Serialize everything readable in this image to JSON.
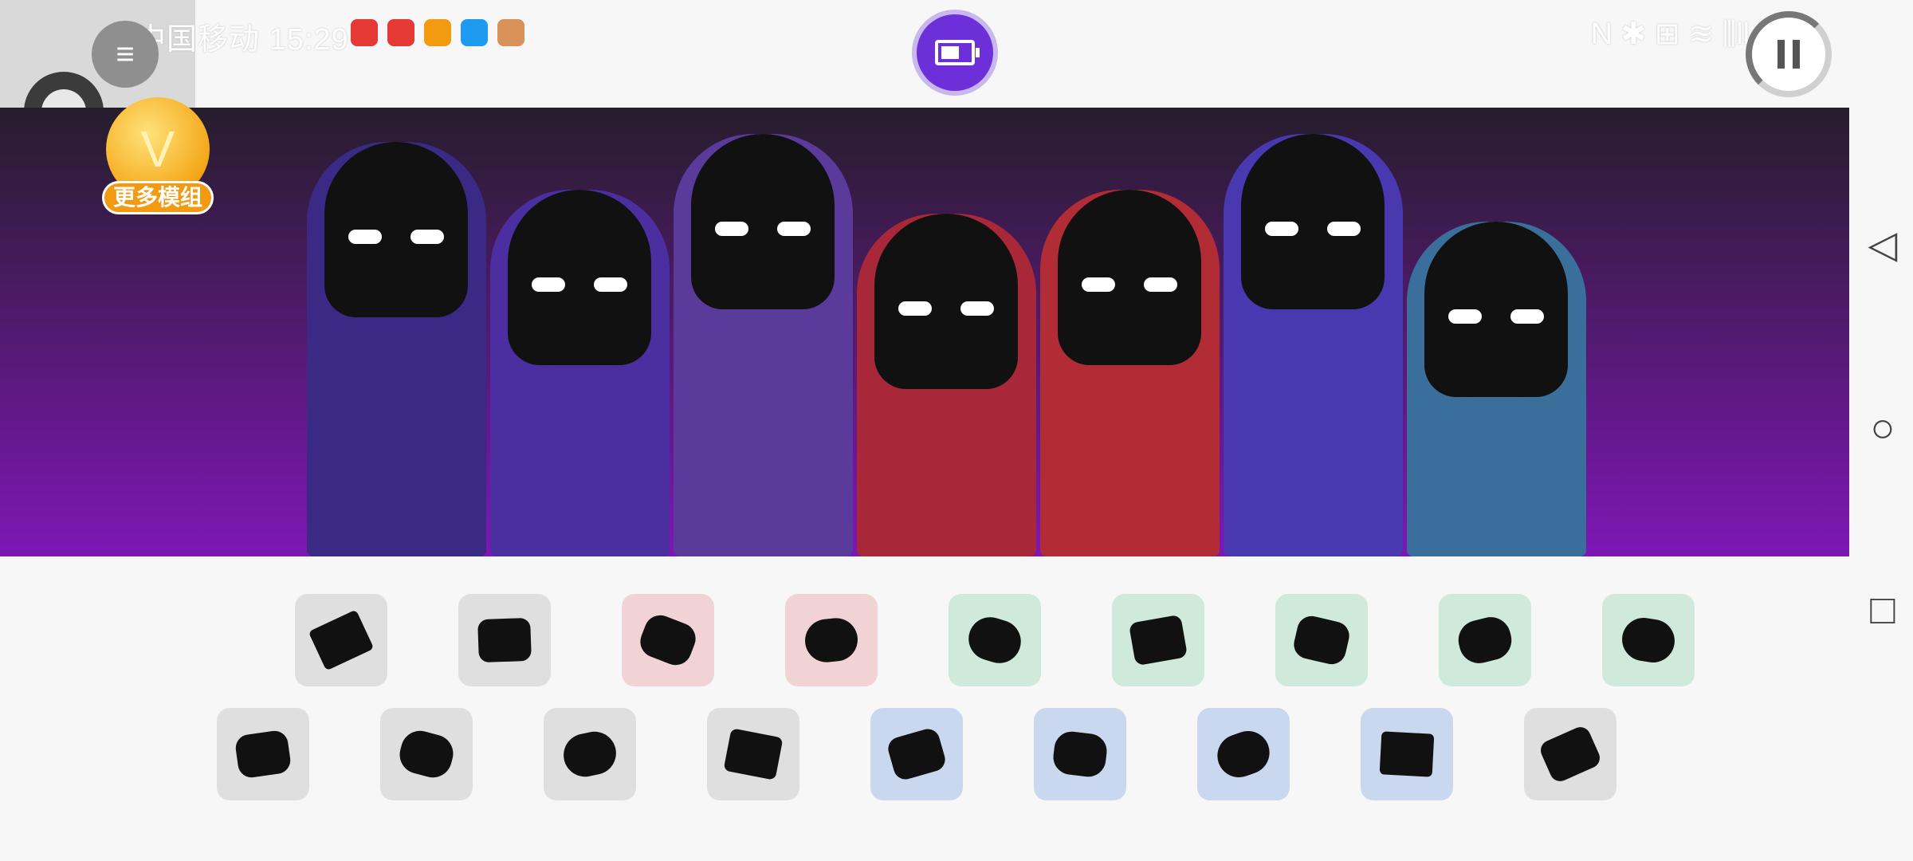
{
  "status_bar": {
    "carrier": "中国移动",
    "time": "15:29",
    "right_indicators": "N ✱ ⊞ ≋ ⫼ll ⫼ll",
    "notification_icons": [
      {
        "name": "phone-missed-icon",
        "color": "#e53935"
      },
      {
        "name": "huawei-store-icon",
        "color": "#e53935"
      },
      {
        "name": "pen-app-icon",
        "color": "#f29b11"
      },
      {
        "name": "shield-icon",
        "color": "#1e9bf0"
      },
      {
        "name": "chat-icon",
        "color": "#d9925a"
      }
    ]
  },
  "controls": {
    "menu_icon": "≡",
    "pause_icon": "pause-icon",
    "battery_icon": "battery-icon"
  },
  "vip_badge": {
    "letter": "V",
    "label": "更多模组"
  },
  "nav": {
    "back": "◁",
    "home": "○",
    "recents": "□"
  },
  "colors": {
    "accent": "#6c2fd8",
    "banner_top": "#261d2c",
    "banner_bottom": "#7d17b5",
    "vip": "#f19a12"
  },
  "characters": [
    {
      "name": "purple-horned-mask",
      "color": "#3a2a86"
    },
    {
      "name": "skull-cap-demon",
      "color": "#4b2fa0"
    },
    {
      "name": "tentacle-mask",
      "color": "#5a3a9a"
    },
    {
      "name": "red-hood",
      "color": "#a8283a"
    },
    {
      "name": "cyborg-red-cape",
      "color": "#b12c35"
    },
    {
      "name": "glasses-mask",
      "color": "#4a38b0"
    },
    {
      "name": "blue-equalizer",
      "color": "#3a6f9c"
    }
  ],
  "sound_rows": [
    [
      {
        "name": "sound-icon-1",
        "group": "grey"
      },
      {
        "name": "sound-icon-2",
        "group": "grey"
      },
      {
        "name": "sound-icon-3",
        "group": "red"
      },
      {
        "name": "sound-icon-4",
        "group": "red"
      },
      {
        "name": "sound-icon-5",
        "group": "green"
      },
      {
        "name": "sound-icon-6",
        "group": "green"
      },
      {
        "name": "sound-icon-7",
        "group": "green"
      },
      {
        "name": "sound-icon-8",
        "group": "green"
      },
      {
        "name": "sound-icon-9",
        "group": "green"
      }
    ],
    [
      {
        "name": "sound-icon-10",
        "group": "grey"
      },
      {
        "name": "sound-icon-11",
        "group": "grey"
      },
      {
        "name": "sound-icon-12",
        "group": "grey"
      },
      {
        "name": "sound-icon-13",
        "group": "grey"
      },
      {
        "name": "sound-icon-14",
        "group": "blue"
      },
      {
        "name": "sound-icon-15",
        "group": "blue"
      },
      {
        "name": "sound-icon-16",
        "group": "blue"
      },
      {
        "name": "sound-icon-17",
        "group": "blue"
      },
      {
        "name": "sound-icon-18",
        "group": "grey"
      }
    ]
  ]
}
